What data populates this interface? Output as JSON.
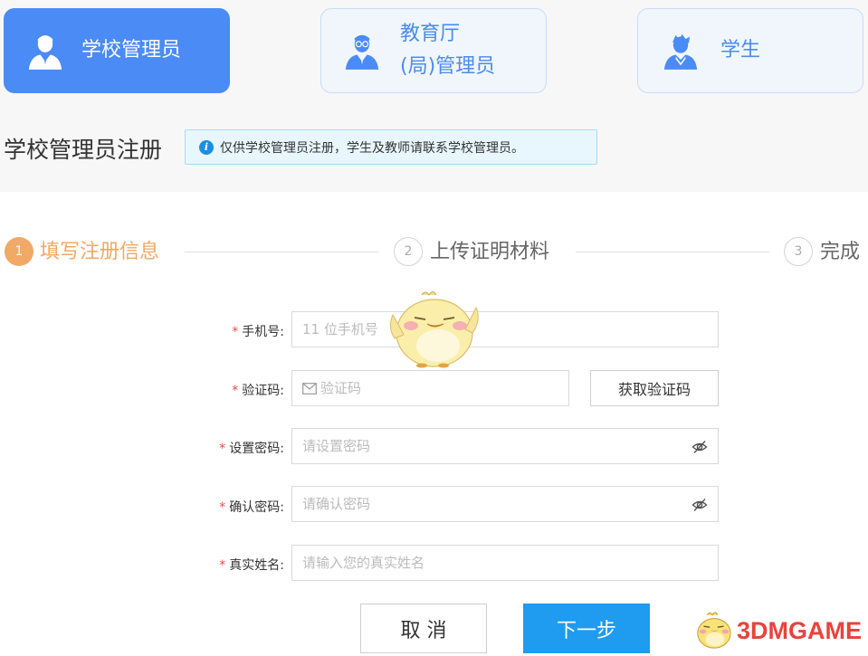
{
  "roles": [
    {
      "label": "学校管理员",
      "icon": "admin-avatar-icon",
      "active": true
    },
    {
      "label_line1": "教育厅",
      "label_line2": "(局)管理员",
      "icon": "bureau-admin-avatar-icon",
      "active": false
    },
    {
      "label": "学生",
      "icon": "student-avatar-icon",
      "active": false
    }
  ],
  "registration": {
    "title": "学校管理员注册",
    "notice": "仅供学校管理员注册，学生及教师请联系学校管理员。"
  },
  "steps": [
    {
      "number": "1",
      "label": "填写注册信息",
      "state": "active"
    },
    {
      "number": "2",
      "label": "上传证明材料",
      "state": "inactive"
    },
    {
      "number": "3",
      "label": "完成",
      "state": "inactive"
    }
  ],
  "form": {
    "required_mark": "*",
    "phone": {
      "label": "手机号:",
      "placeholder": "11 位手机号",
      "value": ""
    },
    "code": {
      "label": "验证码:",
      "placeholder": "验证码",
      "value": "",
      "button": "获取验证码"
    },
    "password": {
      "label": "设置密码:",
      "placeholder": "请设置密码",
      "value": ""
    },
    "confirm": {
      "label": "确认密码:",
      "placeholder": "请确认密码",
      "value": ""
    },
    "name": {
      "label": "真实姓名:",
      "placeholder": "请输入您的真实姓名",
      "value": ""
    }
  },
  "actions": {
    "cancel": "取 消",
    "next": "下一步"
  },
  "watermark": {
    "text": "3DMGAME"
  },
  "colors": {
    "accent_blue": "#4b8bf5",
    "step_active": "#f0a966",
    "primary_button": "#1f9bf0",
    "required": "#f04848"
  }
}
